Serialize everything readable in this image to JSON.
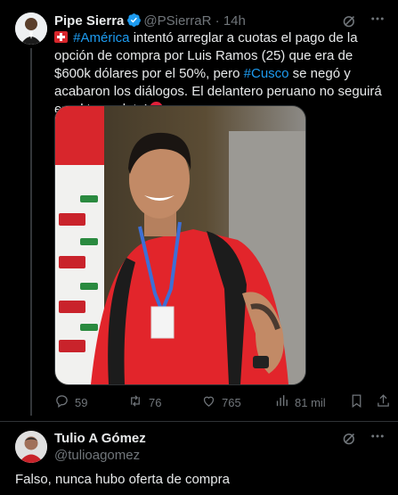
{
  "tweet": {
    "author_name": "Pipe Sierra",
    "handle": "@PSierraR",
    "separator": "·",
    "time": "14h",
    "text_parts": {
      "tag1": "#América",
      "t1": " intentó arreglar a cuotas el pago de la opción de compra por Luis Ramos (25) que era de $600k dólares por el 50%, pero ",
      "tag2": "#Cusco",
      "t2": " se negó y acabaron los diálogos. El delantero peruano no seguirá en el ‘escarlata’"
    },
    "image_alt": "Luis Ramos",
    "actions": {
      "replies": "59",
      "reposts": "76",
      "likes": "765",
      "views": "81 mil"
    }
  },
  "reply": {
    "author_name": "Tulio A Gómez",
    "handle": "@tulioagomez",
    "text": "Falso, nunca hubo oferta de compra"
  },
  "colors": {
    "background": "#000000",
    "text": "#e7e9ea",
    "muted": "#71767b",
    "link": "#1d9bf0",
    "verified": "#1d9bf0"
  },
  "icons": [
    "grok-icon",
    "more-icon",
    "verified-icon",
    "reply-icon",
    "repost-icon",
    "like-icon",
    "views-icon",
    "bookmark-icon",
    "share-icon"
  ]
}
